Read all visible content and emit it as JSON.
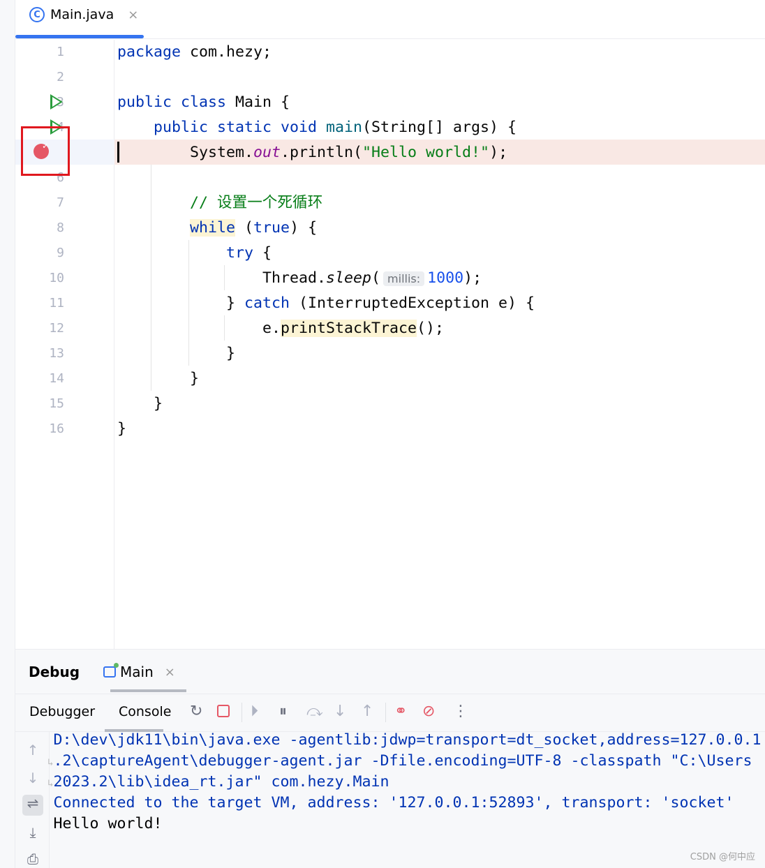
{
  "tab": {
    "title": "Main.java",
    "icon": "class-icon",
    "close": "×"
  },
  "line_numbers": [
    "1",
    "2",
    "3",
    "4",
    "",
    "6",
    "7",
    "8",
    "9",
    "10",
    "11",
    "12",
    "13",
    "14",
    "15",
    "16"
  ],
  "code": [
    [
      {
        "t": "package ",
        "c": "kw"
      },
      {
        "t": "com.hezy;",
        "c": ""
      }
    ],
    [],
    [
      {
        "t": "public class ",
        "c": "kw"
      },
      {
        "t": "Main",
        "c": ""
      },
      {
        "t": " {",
        "c": ""
      }
    ],
    [
      {
        "t": "    public static void ",
        "c": "kw"
      },
      {
        "t": "main",
        "c": "md"
      },
      {
        "t": "(String[] args) {",
        "c": ""
      }
    ],
    [
      {
        "t": "        System.",
        "c": ""
      },
      {
        "t": "out",
        "c": "fld"
      },
      {
        "t": ".println(",
        "c": ""
      },
      {
        "t": "\"Hello world!\"",
        "c": "str"
      },
      {
        "t": ");",
        "c": ""
      }
    ],
    [],
    [
      {
        "t": "        // 设置一个死循环",
        "c": "cm"
      }
    ],
    [
      {
        "t": "        ",
        "c": ""
      },
      {
        "t": "while",
        "c": "kw use"
      },
      {
        "t": " (",
        "c": ""
      },
      {
        "t": "true",
        "c": "kw"
      },
      {
        "t": ") {",
        "c": ""
      }
    ],
    [
      {
        "t": "            ",
        "c": ""
      },
      {
        "t": "try",
        "c": "kw"
      },
      {
        "t": " {",
        "c": ""
      }
    ],
    [
      {
        "t": "                Thread.",
        "c": ""
      },
      {
        "t": "sleep",
        "c": "it"
      },
      {
        "t": "(",
        "c": ""
      },
      {
        "t": "millis:",
        "c": "hint"
      },
      {
        "t": "1000",
        "c": "num"
      },
      {
        "t": ");",
        "c": ""
      }
    ],
    [
      {
        "t": "            } ",
        "c": ""
      },
      {
        "t": "catch",
        "c": "kw"
      },
      {
        "t": " (InterruptedException e) {",
        "c": ""
      }
    ],
    [
      {
        "t": "                e.",
        "c": ""
      },
      {
        "t": "printStackTrace",
        "c": "use"
      },
      {
        "t": "();",
        "c": ""
      }
    ],
    [
      {
        "t": "            }",
        "c": ""
      }
    ],
    [
      {
        "t": "        }",
        "c": ""
      }
    ],
    [
      {
        "t": "    }",
        "c": ""
      }
    ],
    [
      {
        "t": "}",
        "c": ""
      }
    ]
  ],
  "debug": {
    "title": "Debug",
    "session_tab": "Main",
    "session_close": "×",
    "tabs": [
      "Debugger",
      "Console"
    ],
    "active_tab": "Console"
  },
  "console": [
    {
      "wrap": false,
      "text": "D:\\dev\\jdk11\\bin\\java.exe -agentlib:jdwp=transport=dt_socket,address=127.0.0.1"
    },
    {
      "wrap": true,
      "text": ".2\\captureAgent\\debugger-agent.jar -Dfile.encoding=UTF-8 -classpath \"C:\\Users"
    },
    {
      "wrap": true,
      "text": "2023.2\\lib\\idea_rt.jar\" com.hezy.Main"
    },
    {
      "wrap": false,
      "text": "Connected to the target VM, address: '127.0.0.1:52893', transport: 'socket'"
    },
    {
      "wrap": false,
      "text": "Hello world!",
      "color": "#000000"
    }
  ],
  "watermark": "CSDN @何中应",
  "colors": {
    "accent": "#3574f0",
    "breakpoint": "#e55765",
    "highlight_box": "#e0181f",
    "current_line": "#f9e8e4"
  }
}
